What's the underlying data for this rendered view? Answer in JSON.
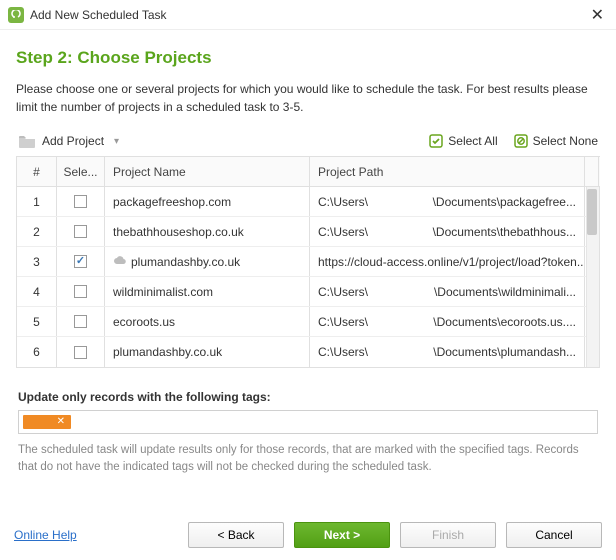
{
  "titlebar": {
    "title": "Add New Scheduled Task"
  },
  "step_title": "Step 2: Choose Projects",
  "description": "Please choose one or several projects for which you would like to schedule the task. For best results please limit the number of projects in a scheduled task to 3-5.",
  "toolbar": {
    "add_project": "Add Project",
    "select_all": "Select All",
    "select_none": "Select None"
  },
  "columns": {
    "num": "#",
    "sel": "Sele...",
    "name": "Project Name",
    "path": "Project Path"
  },
  "rows": [
    {
      "n": "1",
      "checked": false,
      "cloud": false,
      "name": "packagefreeshop.com",
      "path_a": "C:\\Users\\",
      "path_b": "\\Documents\\packagefree..."
    },
    {
      "n": "2",
      "checked": false,
      "cloud": false,
      "name": "thebathhouseshop.co.uk",
      "path_a": "C:\\Users\\",
      "path_b": "\\Documents\\thebathhous..."
    },
    {
      "n": "3",
      "checked": true,
      "cloud": true,
      "name": "plumandashby.co.uk",
      "path_a": "https://cloud-access.online/v1/project/load?token...",
      "path_b": ""
    },
    {
      "n": "4",
      "checked": false,
      "cloud": false,
      "name": "wildminimalist.com",
      "path_a": "C:\\Users\\",
      "path_b": "\\Documents\\wildminimali..."
    },
    {
      "n": "5",
      "checked": false,
      "cloud": false,
      "name": "ecoroots.us",
      "path_a": "C:\\Users\\",
      "path_b": "\\Documents\\ecoroots.us...."
    },
    {
      "n": "6",
      "checked": false,
      "cloud": false,
      "name": "plumandashby.co.uk",
      "path_a": "C:\\Users\\",
      "path_b": "\\Documents\\plumandash..."
    }
  ],
  "tags": {
    "label": "Update only records with the following tags:",
    "chip": "",
    "help": "The scheduled task will update results only for those records, that are marked with the specified tags. Records that do not have the indicated tags will not be checked during the scheduled task."
  },
  "footer": {
    "help": "Online Help",
    "back": "< Back",
    "next": "Next >",
    "finish": "Finish",
    "cancel": "Cancel"
  }
}
